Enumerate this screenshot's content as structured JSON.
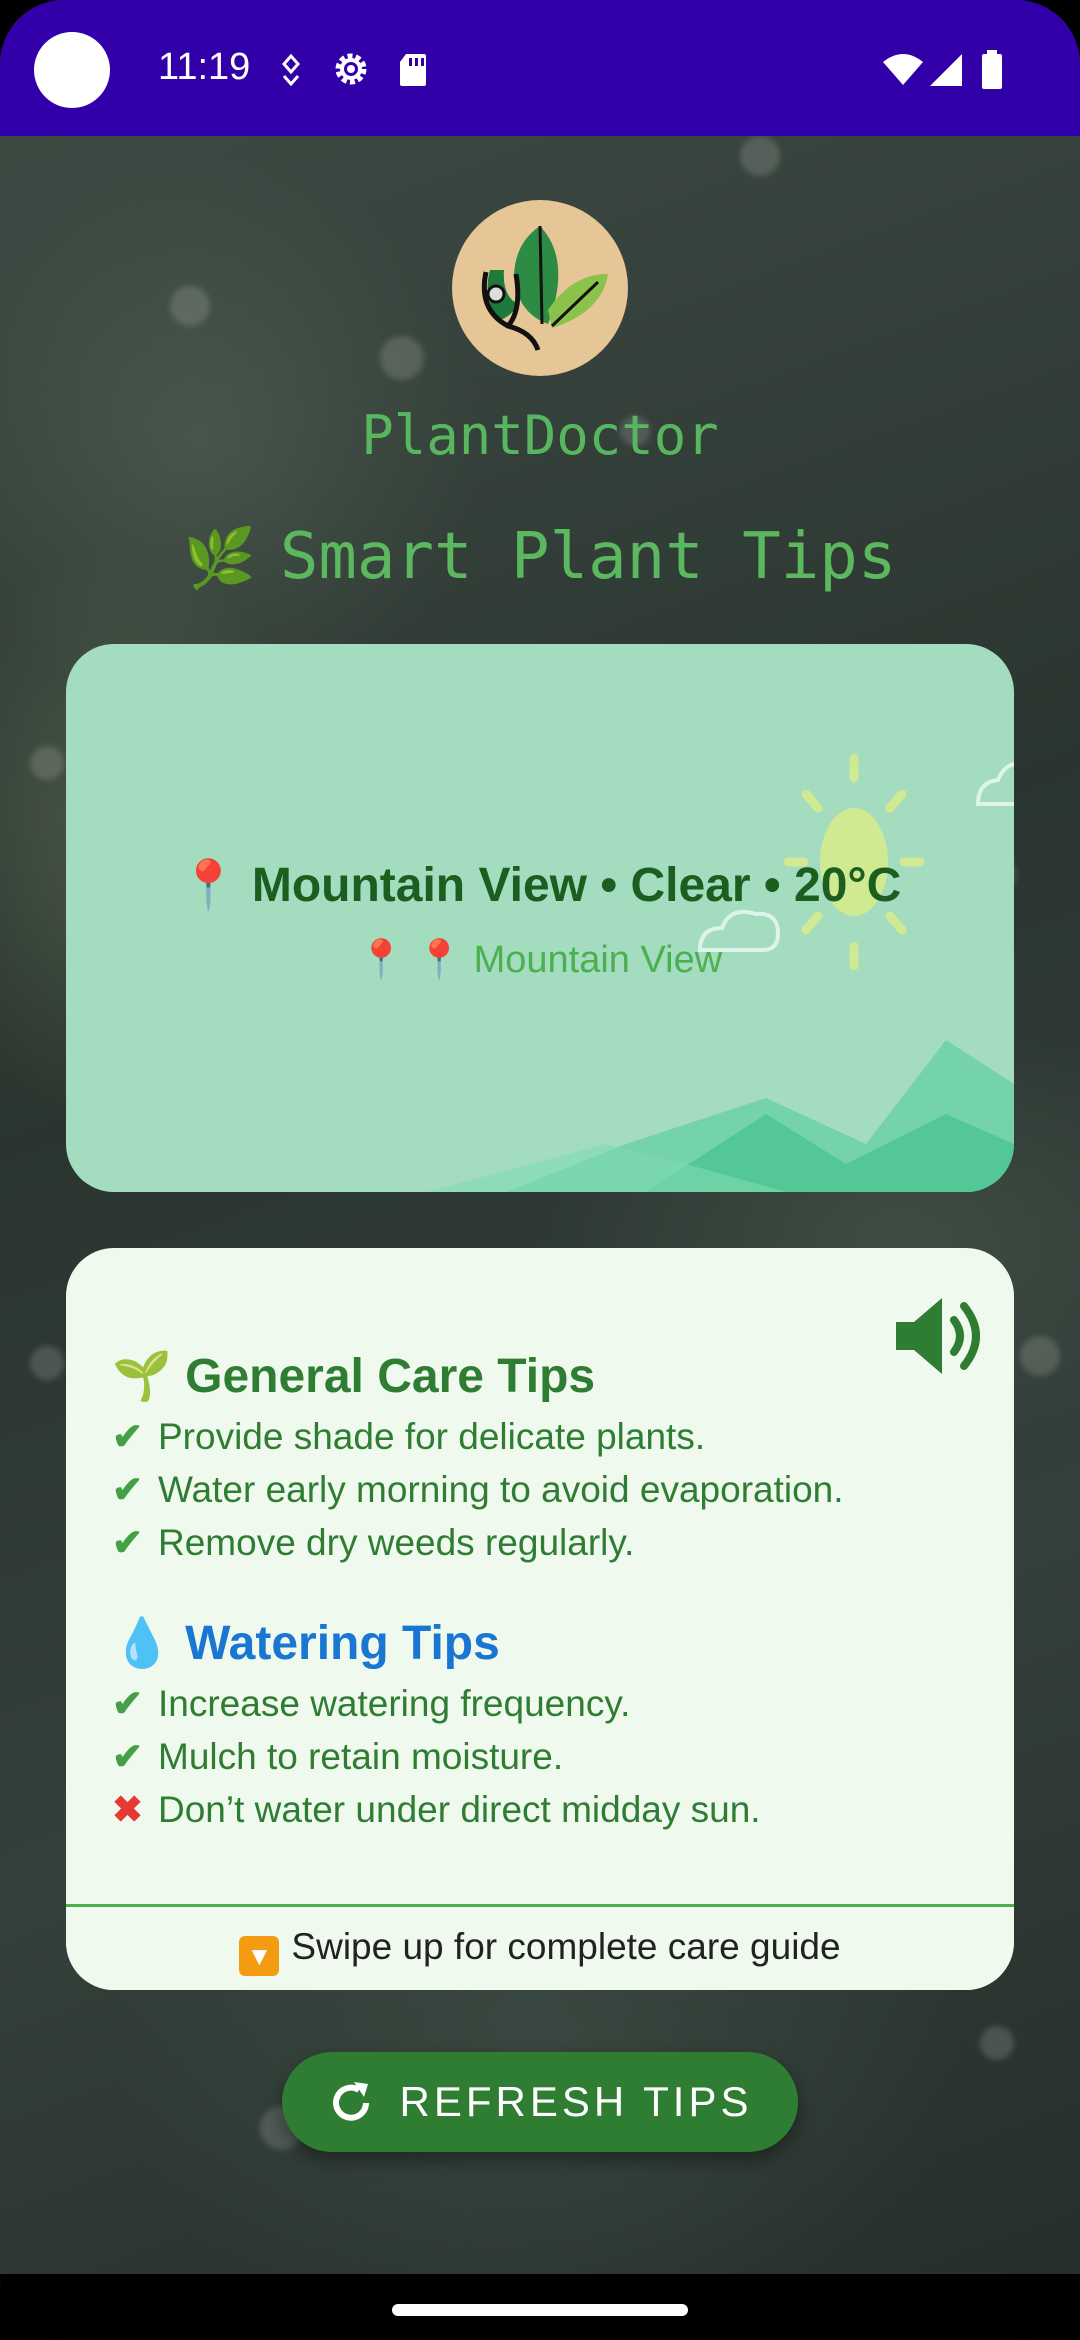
{
  "status_bar": {
    "time": "11:19"
  },
  "app": {
    "name": "PlantDoctor"
  },
  "header": {
    "leaf_icon": "🌿",
    "title": "Smart Plant Tips"
  },
  "weather": {
    "pin_icon": "📍",
    "summary": "Mountain View • Clear • 20°C",
    "location_pins": "📍 📍",
    "location": "Mountain View"
  },
  "tips": {
    "general": {
      "icon": "🌱",
      "title": "General Care Tips",
      "items": [
        {
          "mark": "✔",
          "text": "Provide shade for delicate plants."
        },
        {
          "mark": "✔",
          "text": "Water early morning to avoid evaporation."
        },
        {
          "mark": "✔",
          "text": "Remove dry weeds regularly."
        }
      ]
    },
    "watering": {
      "icon": "💧",
      "title": "Watering Tips",
      "items": [
        {
          "mark": "✔",
          "text": "Increase watering frequency."
        },
        {
          "mark": "✔",
          "text": "Mulch to retain moisture."
        },
        {
          "mark": "✖",
          "text": "Don’t water under direct midday sun."
        }
      ]
    },
    "footer": "Swipe up for complete care guide"
  },
  "refresh_button": {
    "label": "REFRESH TIPS"
  },
  "colors": {
    "status_bar": "#3200a8",
    "accent_green": "#2e7d32",
    "weather_card": "#a4dcc0",
    "water_blue": "#1976d2"
  }
}
